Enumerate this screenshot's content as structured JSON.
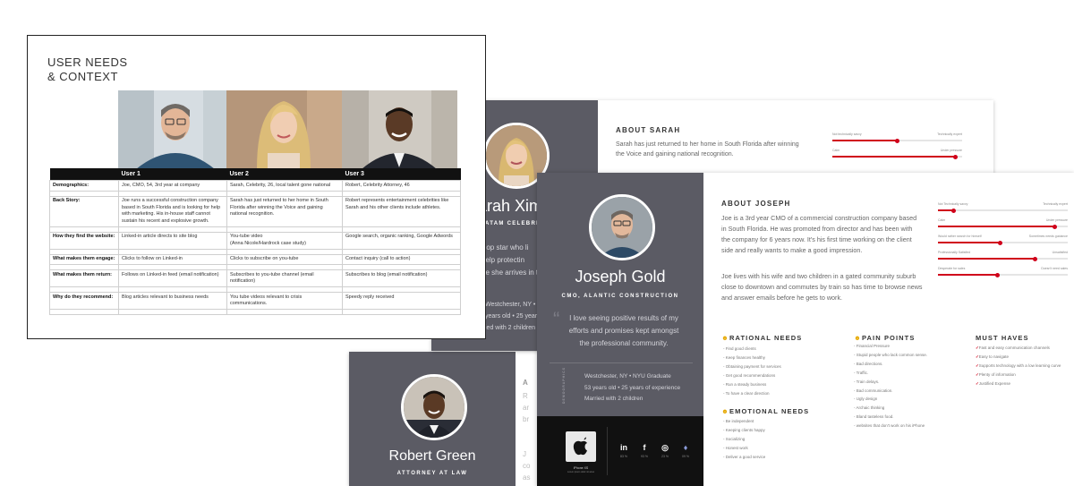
{
  "robert": {
    "name": "Robert Green",
    "role": "ATTORNEY AT LAW",
    "fragments": [
      "A",
      "R",
      "ar",
      "br",
      "J",
      "co",
      "as"
    ]
  },
  "sarah": {
    "name_fragment": "Sarah Ximi",
    "role_fragment": "ATAM CELEBRITY",
    "quote_fragment": "Pop star who lives... help protecting... she arrives in t...",
    "quote_lines": [
      "Pop star who li",
      "help protectin",
      "he she arrives in t"
    ],
    "demographics": [
      "Westchester, NY • NYU",
      "years old • 25 years",
      "ied with 2 children"
    ],
    "about_title": "ABOUT SARAH",
    "about_text": "Sarah has just returned to her home in South Florida after winning the Voice and gaining national recognition.",
    "sliders": [
      {
        "left": "Not technically savvy",
        "right": "Technically expert",
        "value": 0.5
      },
      {
        "left": "Calm",
        "right": "Under pressure",
        "value": 0.95
      }
    ]
  },
  "joseph": {
    "name": "Joseph Gold",
    "role": "CMO, ALANTIC CONSTRUCTION",
    "quote": "I love seeing positive results of my efforts and promises kept amongst the professional community.",
    "demo_label": "DEMOGRAPHICS",
    "demographics": [
      "Westchester, NY • NYU Graduate",
      "53 years old • 25 years of experience",
      "Married with 2 children"
    ],
    "phone": {
      "name": "iPhone XS",
      "sub": "Lorem ipsum dolor sit amet"
    },
    "social": [
      {
        "icon": "in",
        "value": "83 %"
      },
      {
        "icon": "f",
        "value": "93 %"
      },
      {
        "icon": "◎",
        "value": "23 %"
      },
      {
        "icon": "♦",
        "value": "09 %"
      }
    ],
    "about_title": "ABOUT JOSEPH",
    "about_p1": "Joe is a 3rd year CMO of a commercial construction company based in South Florida. He was promoted from director and has been with the company for 6 years now. It's his first time working on the client side and really wants to make a good impression.",
    "about_p2": "Joe lives with his wife and two children in a gated community suburb close to downtown and commutes by train so has time to browse news and answer emails before he gets to work.",
    "sliders": [
      {
        "left": "Not Technically savvy",
        "right": "Technically expert",
        "value": 0.12
      },
      {
        "left": "Calm",
        "right": "Under pressure",
        "value": 0.9
      },
      {
        "left": "Would rather search for himself",
        "right": "Sometimes needs guidance",
        "value": 0.48
      },
      {
        "left": "Professionally Satisfied",
        "right": "Unsatisfied",
        "value": 0.75
      },
      {
        "left": "Desperate for sales",
        "right": "Doesn't need sales",
        "value": 0.46
      }
    ],
    "rational": {
      "title": "RATIONAL NEEDS",
      "items": [
        "Find good clients",
        "Keep finances healthy",
        "Obtaining payment for services",
        "Get good recommendations",
        "Run a steady business",
        "To have a clear direction"
      ]
    },
    "emotional": {
      "title": "EMOTIONAL NEEDS",
      "items": [
        "Be independent",
        "Keeping clients happy",
        "Socializing",
        "Honest work",
        "Deliver a good service"
      ]
    },
    "pain": {
      "title": "PAIN POINTS",
      "items": [
        "Financial Pressure",
        "Stupid people who lack common sense.",
        "Bad directions.",
        "Traffic.",
        "Train delays.",
        "Bad communication.",
        "Ugly design",
        "Archaic thinking",
        "Bland tasteless food.",
        "websites that don't work on his iPhone"
      ]
    },
    "must": {
      "title": "MUST HAVES",
      "items": [
        "Fast and easy communication channels",
        "Easy to navigate",
        "Supports technology with a low learning curve",
        "Plenty of information",
        "Justified Expense"
      ]
    }
  },
  "needs": {
    "title_line1": "USER NEEDS",
    "title_line2": "& CONTEXT",
    "columns": [
      "",
      "User 1",
      "User 2",
      "User 3"
    ],
    "rows": [
      {
        "label": "Demographics:",
        "cells": [
          "Joe, CMO, 54, 3rd year at company",
          "Sarah, Celebrity, 26, local talent gone national",
          "Robert, Celebrity Attorney, 46"
        ]
      },
      {
        "label": "Back Story:",
        "cells": [
          "Joe runs a successful construction company based in South Florida and is looking for help with marketing. His in-house staff cannot sustain his recent and explosive growth.",
          "Sarah has just returned to her home in South Florida after winning the Voice and gaining national recognition.",
          "Robert represents entertainment celebrities like Sarah and his other clients include athletes."
        ]
      },
      {
        "label": "How they find the website:",
        "cells": [
          "Linked-in article directs to site blog",
          "You-tube video\n(Anna Nicole/Hardrock case study)",
          "Google search, organic ranking, Google Adwords"
        ]
      },
      {
        "label": "What makes them engage:",
        "cells": [
          "Clicks to follow on Linked-in",
          "Clicks to subscribe on you-tube",
          "Contact inquiry (call to action)"
        ]
      },
      {
        "label": "What makes them return:",
        "cells": [
          "Follows on Linked-in feed (email notification)",
          "Subscribes to you-tube channel (email notification)",
          "Subscribes to blog (email notification)"
        ]
      },
      {
        "label": "Why do they recommend:",
        "cells": [
          "Blog articles relevant to business needs",
          "You tube videos relevant to crisis communications.",
          "Speedy reply received"
        ]
      }
    ]
  },
  "colors": {
    "sidebar": "#5b5b64",
    "accent": "#d0021b",
    "footer": "#111111"
  }
}
